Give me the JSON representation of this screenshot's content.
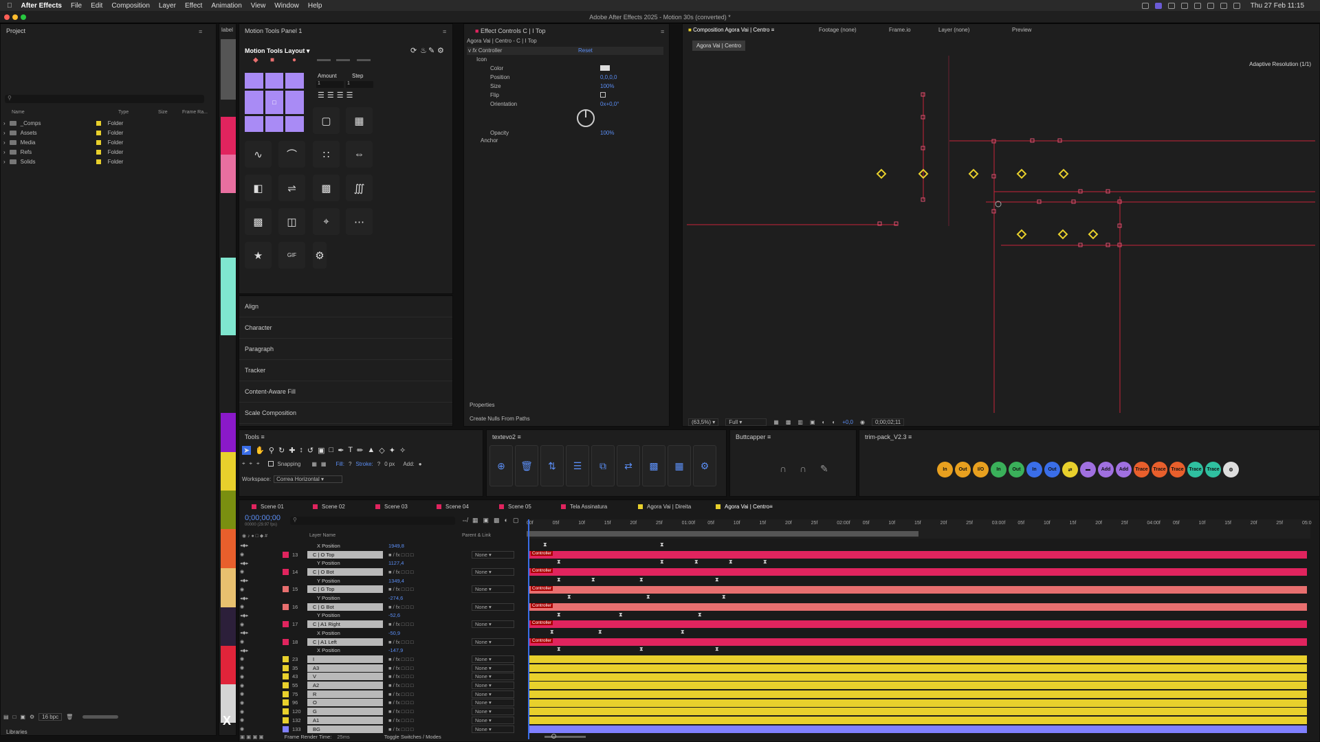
{
  "menubar": {
    "app": "After Effects",
    "items": [
      "File",
      "Edit",
      "Composition",
      "Layer",
      "Effect",
      "Animation",
      "View",
      "Window",
      "Help"
    ],
    "clock": "Thu 27 Feb 11:15"
  },
  "window_title": "Adobe After Effects 2025 - Motion 30s (converted) *",
  "project": {
    "title": "Project",
    "search_placeholder": "",
    "columns": [
      "Name",
      "Type",
      "Size",
      "Frame Ra..."
    ],
    "items": [
      {
        "name": "_Comps",
        "type": "Folder"
      },
      {
        "name": "Assets",
        "type": "Folder"
      },
      {
        "name": "Media",
        "type": "Folder"
      },
      {
        "name": "Refs",
        "type": "Folder"
      },
      {
        "name": "Solids",
        "type": "Folder"
      }
    ],
    "bpc": "16 bpc",
    "libraries": "Libraries"
  },
  "label_tab": "label",
  "motion_tools": {
    "tab": "Motion Tools Panel 1",
    "layout": "Motion Tools Layout",
    "amount": "Amount",
    "step": "Step",
    "amount_val": "1",
    "step_val": "1",
    "gif": "GIF"
  },
  "sections": [
    "Align",
    "Character",
    "Paragraph",
    "Tracker",
    "Content-Aware Fill",
    "Scale Composition"
  ],
  "effect_controls": {
    "tab": "Effect Controls C | I Top",
    "breadcrumb": "Agora Vai | Centro - C | I Top",
    "controller": "Controller",
    "reset": "Reset",
    "icon": "Icon",
    "rows": [
      {
        "k": "Color",
        "v": ""
      },
      {
        "k": "Position",
        "v": "0,0,0,0"
      },
      {
        "k": "Size",
        "v": "100%"
      },
      {
        "k": "Flip",
        "v": ""
      },
      {
        "k": "Orientation",
        "v": "0x+0,0°"
      },
      {
        "k": "Opacity",
        "v": "100%"
      }
    ],
    "anchor": "Anchor",
    "properties": "Properties",
    "create_nulls": "Create Nulls From Paths"
  },
  "viewer": {
    "tabs": [
      "Composition Agora Vai | Centro",
      "Footage (none)",
      "Frame.io",
      "Layer (none)",
      "Preview"
    ],
    "comp_chip": "Agora Vai | Centro",
    "adaptive": "Adaptive Resolution (1/1)",
    "zoom": "(63,5%)",
    "quality": "Full",
    "exposure": "+0,0",
    "timecode": "0;00;02;11"
  },
  "tools": {
    "tab": "Tools",
    "snapping": "Snapping",
    "fill": "Fill:",
    "stroke": "Stroke:",
    "px": "0 px",
    "add": "Add:",
    "workspace_label": "Workspace:",
    "workspace": "Correa Horizontal"
  },
  "textevo": {
    "tab": "textevo2"
  },
  "buttcapper": {
    "tab": "Buttcapper"
  },
  "trimpack": {
    "tab": "trim-pack_V2.3",
    "buttons": [
      "In",
      "Out",
      "I/O",
      "In",
      "Out",
      "In",
      "Out",
      "",
      "",
      "Add",
      "Add",
      "Trace",
      "Trace",
      "Trace",
      "Trace",
      "Trace",
      ""
    ]
  },
  "timeline": {
    "tabs": [
      {
        "name": "Scene 01",
        "color": "#e0245e"
      },
      {
        "name": "Scene 02",
        "color": "#e0245e"
      },
      {
        "name": "Scene 03",
        "color": "#e0245e"
      },
      {
        "name": "Scene 04",
        "color": "#e0245e"
      },
      {
        "name": "Scene 05",
        "color": "#e0245e"
      },
      {
        "name": "Tela Assinatura",
        "color": "#e0245e"
      },
      {
        "name": "Agora Vai | Direita",
        "color": "#e8d02c"
      },
      {
        "name": "Agora Vai | Centro",
        "color": "#e8d02c"
      }
    ],
    "timecode": "0;00;00;00",
    "sub_timecode": "00000 (29.97 fps)",
    "col_layer": "Layer Name",
    "col_parent": "Parent & Link",
    "ruler": [
      "00f",
      "05f",
      "10f",
      "15f",
      "20f",
      "25f",
      "01:00f",
      "05f",
      "10f",
      "15f",
      "20f",
      "25f",
      "02:00f",
      "05f",
      "10f",
      "15f",
      "20f",
      "25f",
      "03:00f",
      "05f",
      "10f",
      "15f",
      "20f",
      "25f",
      "04:00f",
      "05f",
      "10f",
      "15f",
      "20f",
      "25f",
      "05:0"
    ],
    "controller_label": "Controller",
    "frame_render": "Frame Render Time:",
    "render_ms": "25ms",
    "toggle": "Toggle Switches / Modes",
    "rows": [
      {
        "kind": "prop",
        "name": "X Position",
        "val": "1949,8"
      },
      {
        "kind": "layer",
        "num": "13",
        "name": "C | O Top",
        "par": "None",
        "col": "#e0245e"
      },
      {
        "kind": "prop",
        "name": "Y Position",
        "val": "1127,4"
      },
      {
        "kind": "layer",
        "num": "14",
        "name": "C | O Bot",
        "par": "None",
        "col": "#e0245e"
      },
      {
        "kind": "prop",
        "name": "Y Position",
        "val": "1349,4"
      },
      {
        "kind": "layer",
        "num": "15",
        "name": "C | G Top",
        "par": "None",
        "col": "#e86f6f"
      },
      {
        "kind": "prop",
        "name": "Y Position",
        "val": "-274,6"
      },
      {
        "kind": "layer",
        "num": "16",
        "name": "C | G Bot",
        "par": "None",
        "col": "#e86f6f"
      },
      {
        "kind": "prop",
        "name": "Y Position",
        "val": "-52,6"
      },
      {
        "kind": "layer",
        "num": "17",
        "name": "C | A1 Right",
        "par": "None",
        "col": "#e0245e"
      },
      {
        "kind": "prop",
        "name": "X Position",
        "val": "-50,9"
      },
      {
        "kind": "layer",
        "num": "18",
        "name": "C | A1 Left",
        "par": "None",
        "col": "#e0245e"
      },
      {
        "kind": "prop",
        "name": "X Position",
        "val": "-147,9"
      },
      {
        "kind": "layer",
        "num": "23",
        "name": "I",
        "par": "None",
        "col": "#e8d02c"
      },
      {
        "kind": "layer",
        "num": "35",
        "name": "A3",
        "par": "None",
        "col": "#e8d02c"
      },
      {
        "kind": "layer",
        "num": "43",
        "name": "V",
        "par": "None",
        "col": "#e8d02c"
      },
      {
        "kind": "layer",
        "num": "55",
        "name": "A2",
        "par": "None",
        "col": "#e8d02c"
      },
      {
        "kind": "layer",
        "num": "75",
        "name": "R",
        "par": "None",
        "col": "#e8d02c"
      },
      {
        "kind": "layer",
        "num": "96",
        "name": "O",
        "par": "None",
        "col": "#e8d02c"
      },
      {
        "kind": "layer",
        "num": "120",
        "name": "G",
        "par": "None",
        "col": "#e8d02c"
      },
      {
        "kind": "layer",
        "num": "132",
        "name": "A1",
        "par": "None",
        "col": "#e8d02c"
      },
      {
        "kind": "layer",
        "num": "133",
        "name": "BG",
        "par": "None",
        "col": "#8080ff"
      }
    ]
  }
}
